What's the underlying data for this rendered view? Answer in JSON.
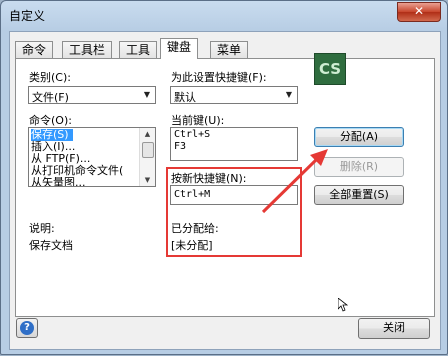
{
  "window": {
    "title": "自定义",
    "close_glyph": "✕"
  },
  "tabs": [
    {
      "label": "命令"
    },
    {
      "label": "工具栏"
    },
    {
      "label": "工具"
    },
    {
      "label": "键盘"
    },
    {
      "label": "菜单"
    }
  ],
  "left": {
    "category_label": "类别(C):",
    "category_value": "文件(F)",
    "commands_label": "命令(O):",
    "commands": [
      "保存(S)",
      "插入(I)...",
      "从 FTP(F)...",
      "从打印机命令文件(",
      "从矢量图..."
    ],
    "selected_command_index": 0,
    "description_label": "说明:",
    "description_text": "保存文档"
  },
  "right": {
    "set_for_label": "为此设置快捷键(F):",
    "set_for_value": "默认",
    "current_keys_label": "当前键(U):",
    "current_keys": [
      "Ctrl+S",
      "F3"
    ],
    "new_key_label": "按新快捷键(N):",
    "new_key_value": "Ctrl+M",
    "assigned_to_label": "已分配给:",
    "assigned_to_value": "[未分配]"
  },
  "buttons": {
    "assign": "分配(A)",
    "remove": "删除(R)",
    "reset_all": "全部重置(S)",
    "close": "关闭",
    "help_glyph": "?"
  },
  "app_logo_text": "CS",
  "accent_color": "#e53935"
}
